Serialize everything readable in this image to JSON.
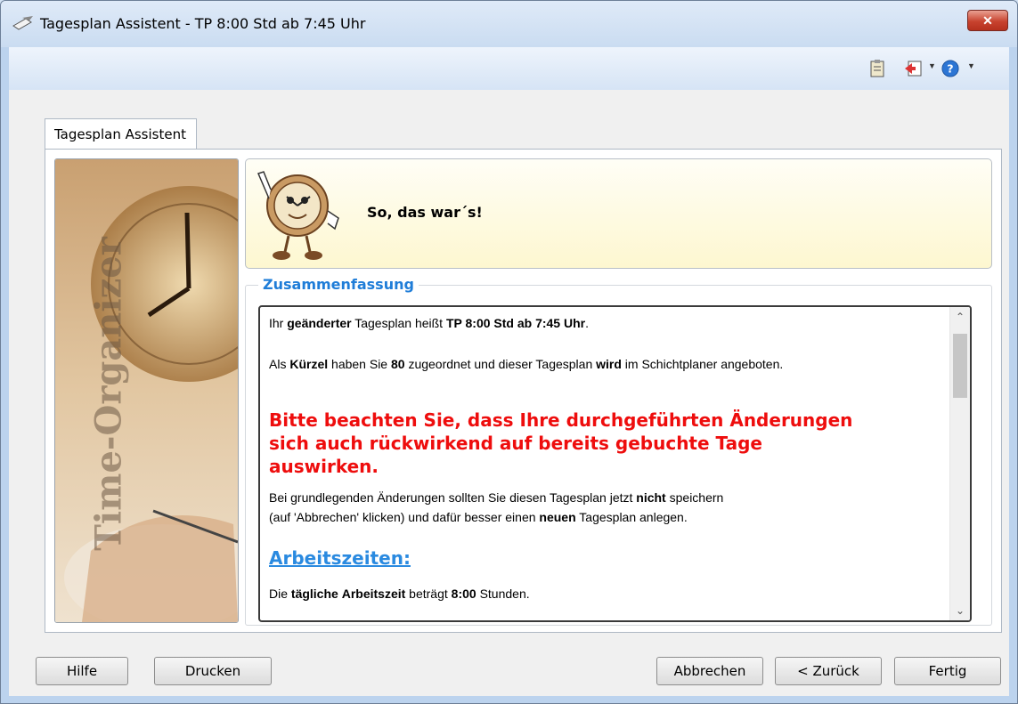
{
  "window": {
    "title": "Tagesplan Assistent - TP 8:00 Std ab 7:45 Uhr",
    "close_label": "✕"
  },
  "tabs": [
    {
      "label": "Tagesplan Assistent"
    }
  ],
  "side_image": {
    "watermark": "Time-Organizer"
  },
  "header": {
    "message": "So, das war´s!"
  },
  "summary": {
    "group_title": "Zusammenfassung",
    "line1": {
      "a": "Ihr ",
      "b": "geänderter",
      "c": " Tagesplan heißt ",
      "d": "TP 8:00 Std ab 7:45 Uhr",
      "e": "."
    },
    "line2": {
      "a": "Als ",
      "b": "Kürzel",
      "c": " haben Sie ",
      "d": "80",
      "e": " zugeordnet und dieser Tagesplan ",
      "f": "wird",
      "g": " im Schichtplaner angeboten."
    },
    "warning": {
      "l1": "Bitte beachten Sie, dass Ihre durchgeführten Änderungen",
      "l2": "sich auch rückwirkend auf bereits gebuchte Tage",
      "l3": "auswirken."
    },
    "hint1": {
      "a": "Bei grundlegenden Änderungen sollten Sie diesen Tagesplan jetzt ",
      "b": "nicht",
      "c": " speichern"
    },
    "hint2": {
      "a": "(auf 'Abbrechen' klicken) und dafür besser einen ",
      "b": "neuen",
      "c": " Tagesplan anlegen."
    },
    "section_heading": "Arbeitszeiten:",
    "line3": {
      "a": "Die ",
      "b": "tägliche",
      "c": " ",
      "d": "Arbeitszeit",
      "e": " beträgt ",
      "f": "8:00",
      "g": " Stunden."
    }
  },
  "buttons": {
    "help": "Hilfe",
    "print": "Drucken",
    "cancel": "Abbrechen",
    "back": "< Zurück",
    "finish": "Fertig"
  },
  "icons": {
    "title": "notepad-pen-icon",
    "toolbar": [
      "clipboard-icon",
      "exit-icon",
      "dropdown-arrow-icon",
      "help-icon",
      "dropdown-arrow-icon"
    ]
  },
  "colors": {
    "warning": "#ee0d0d",
    "heading": "#2a8ae0",
    "group_title": "#1f7dd8"
  }
}
